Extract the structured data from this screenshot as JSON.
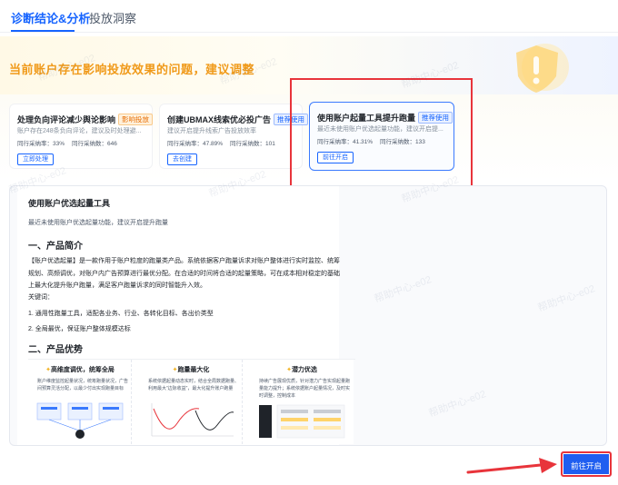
{
  "tabs": [
    {
      "label": "诊断结论&分析"
    },
    {
      "label": "投放洞察"
    }
  ],
  "banner": {
    "title": "当前账户存在影响投放效果的问题，建议调整"
  },
  "cards": [
    {
      "title": "处理负向评论减少舆论影响",
      "tag": "影响投放",
      "desc": "账户存在248条负向评论，建议及时处理避...",
      "stat1": "同行采纳率：33%",
      "stat2": "同行采纳数：646",
      "button": "立即处理"
    },
    {
      "title": "创建UBMAX线索优必投广告",
      "tag": "推荐使用",
      "desc": "建议开启提升线索广告投放效率",
      "stat1": "同行采纳率：47.89%",
      "stat2": "同行采纳数：101",
      "button": "去创建"
    },
    {
      "title": "使用账户起量工具提升跑量",
      "tag": "推荐使用",
      "desc": "最近未使用账户优选起量功能，建议开启提...",
      "stat1": "同行采纳率：41.31%",
      "stat2": "同行采纳数：133",
      "button": "前往开启"
    }
  ],
  "detail": {
    "title": "使用账户优选起量工具",
    "subtitle": "最近未使用账户优选起量功能，建议开启提升跑量",
    "section1": "一、产品简介",
    "paragraph": "【账户优选起量】是一款作用于账户粒度的跑量类产品。系统依据客户跑量诉求对账户整体进行实时监控、统筹规划、高频调优，对账户内广告预算进行最优分配。在合适的时间将合适的起量策略，可在成本相对稳定的基础上最大化提升账户跑量，满足客户跑量诉求的同时智能升入效。",
    "keywords_label": "关键词：",
    "list": [
      "1. 通用性跑量工具，适配各业务、行业、各转化目标、各出价类型",
      "2. 全局最优，保证账户整体规模达标"
    ],
    "section2": "二、产品优势",
    "features": [
      {
        "title": "高维度调优，统筹全局",
        "desc": "账户维度监控起量状况，统筹跑量状况，广告间预算灵活分配，以最少付出实现跑量目标"
      },
      {
        "title": "跑量最大化",
        "desc": "系统依据起量动态实时，结合全局数据跑量、利用最大“边际收益”，最大化提升账户跑量"
      },
      {
        "title": "潜力优选",
        "desc": "持续广告展现优质，针对潜力广告实现起量跑量能力提升；系统依据账户起量情况，及时实时调整，控制成本"
      }
    ]
  },
  "go_button": "前往开启",
  "watermark": "帮助中心-e02",
  "colors": {
    "accent": "#1664ff",
    "warning": "#f09a1a",
    "highlight": "#e8343b"
  }
}
